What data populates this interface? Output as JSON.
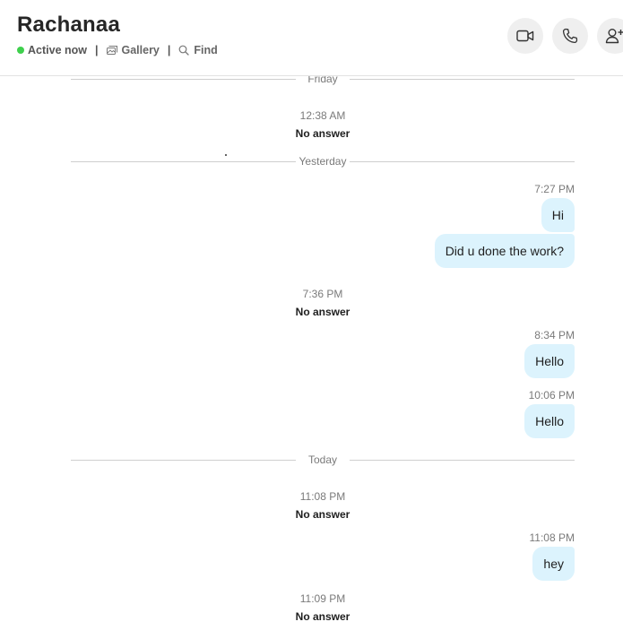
{
  "header": {
    "title": "Rachanaa",
    "status": "Active now",
    "separator": "|",
    "gallery": "Gallery",
    "find": "Find",
    "status_color": "#3fd04d",
    "buttons": [
      {
        "icon": "video-camera-icon"
      },
      {
        "icon": "phone-icon"
      },
      {
        "icon": "add-person-icon"
      }
    ]
  },
  "dividers": {
    "friday": "Friday",
    "yesterday": "Yesterday",
    "today": "Today"
  },
  "calls": [
    {
      "time": "12:38 AM",
      "status": "No answer"
    },
    {
      "time": "7:36 PM",
      "status": "No answer"
    },
    {
      "time": "11:08 PM",
      "status": "No answer"
    },
    {
      "time": "11:09 PM",
      "status": "No answer"
    }
  ],
  "messages": [
    {
      "time": "7:27 PM",
      "text": "Hi"
    },
    {
      "time": "",
      "text": "Did u done the work?"
    },
    {
      "time": "8:34 PM",
      "text": "Hello"
    },
    {
      "time": "10:06 PM",
      "text": "Hello"
    },
    {
      "time": "11:08 PM",
      "text": "hey"
    }
  ],
  "colors": {
    "bubble": "#dcf3fd",
    "button_bg": "#efefef"
  }
}
